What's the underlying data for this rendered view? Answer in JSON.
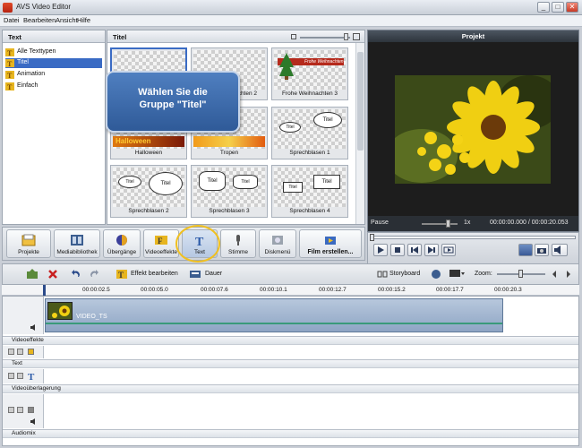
{
  "window": {
    "title": "AVS Video Editor",
    "close_glyph": "✕"
  },
  "menu": [
    "Datei",
    "Bearbeiten",
    "Ansicht",
    "Hilfe"
  ],
  "left_panel": {
    "header": "Text",
    "items": [
      {
        "label": "Alle Texttypen",
        "icon": "text-type-icon",
        "selected": false
      },
      {
        "label": "Titel",
        "icon": "text-type-icon",
        "selected": true
      },
      {
        "label": "Animation",
        "icon": "text-type-icon",
        "selected": false
      },
      {
        "label": "Einfach",
        "icon": "text-type-icon",
        "selected": false
      }
    ]
  },
  "mid_panel": {
    "header": "Titel",
    "thumbnails": [
      {
        "caption": ""
      },
      {
        "caption": "Frohe Weihnachten 2"
      },
      {
        "caption": "Frohe Weihnachten 3"
      },
      {
        "caption": "Halloween"
      },
      {
        "caption": "Tropen"
      },
      {
        "caption": "Sprechblasen 1"
      },
      {
        "caption": "Sprechblasen 2"
      },
      {
        "caption": "Sprechblasen 3"
      },
      {
        "caption": "Sprechblasen 4"
      }
    ],
    "thumb_text": {
      "weihnachten_banner": "Frohe Weihnachten",
      "halloween_banner": "Halloween",
      "bubble_titel": "Titel"
    }
  },
  "callout": {
    "line1": "Wählen Sie die",
    "line2": "Gruppe \"Titel\""
  },
  "project": {
    "header": "Projekt",
    "status": "Pause",
    "speed": "1x",
    "time": "00:00:00.000 / 00:00:20.053"
  },
  "toolbar": {
    "buttons": [
      {
        "label": "Projekte",
        "icon": "projects-icon"
      },
      {
        "label": "Mediabibliothek",
        "icon": "media-library-icon"
      },
      {
        "label": "Übergänge",
        "icon": "transitions-icon"
      },
      {
        "label": "Videoeffekte",
        "icon": "video-effects-icon"
      },
      {
        "label": "Text",
        "icon": "text-icon"
      },
      {
        "label": "Stimme",
        "icon": "microphone-icon"
      },
      {
        "label": "Diskmenü",
        "icon": "disc-menu-icon"
      },
      {
        "label": "Film erstellen...",
        "icon": "create-movie-icon"
      }
    ]
  },
  "timeline_bar": {
    "effect_edit": "Effekt bearbeiten",
    "duration": "Dauer",
    "storyboard": "Storyboard",
    "zoom": "Zoom:"
  },
  "ruler_ticks": [
    "00:00:02.5",
    "00:00:05.0",
    "00:00:07.6",
    "00:00:10.1",
    "00:00:12.7",
    "00:00:15.2",
    "00:00:17.7",
    "00:00:20.3"
  ],
  "tracks": {
    "clip_name": "VIDEO_TS",
    "sections": [
      "Videoeffekte",
      "Text",
      "Videoüberlagerung",
      "Audiomix"
    ]
  },
  "colors": {
    "accent": "#3a6bc4",
    "callout": "#3b68a8",
    "highlight": "#f0c020"
  }
}
